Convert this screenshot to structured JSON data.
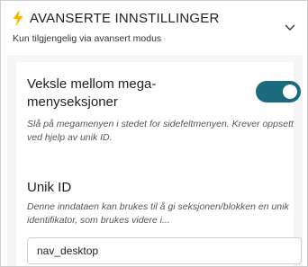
{
  "section": {
    "title": "AVANSERTE INNSTILLINGER",
    "subtitle": "Kun tilgjengelig via avansert modus",
    "icon": "lightning-bolt-icon",
    "collapse_icon": "chevron-down-icon",
    "accent_color": "#f5b400"
  },
  "mega_toggle": {
    "label": "Veksle mellom mega-menyseksjoner",
    "description": "Slå på megamenyen i stedet for sidefeltmenyen. Krever oppsett ved hjelp av unik ID.",
    "checked": true,
    "color": "#1b6b7d"
  },
  "unique_id": {
    "label": "Unik ID",
    "description": "Denne inndataen kan brukes til å gi seksjonen/blokken en unik identifikator, som brukes videre i...",
    "value": "nav_desktop"
  }
}
